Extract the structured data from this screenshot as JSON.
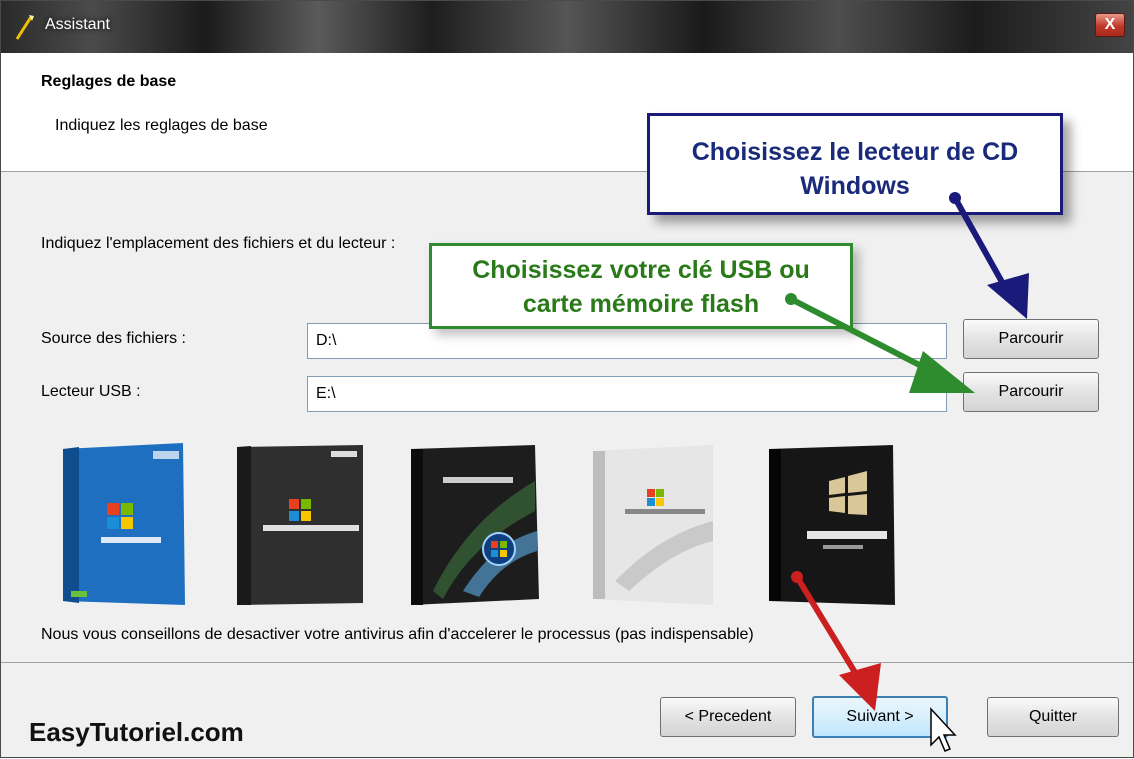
{
  "window": {
    "title": "Assistant",
    "close_label": "X"
  },
  "header": {
    "title": "Reglages de base",
    "subtitle": "Indiquez les reglages de base"
  },
  "main": {
    "intro": "Indiquez l'emplacement des fichiers et du lecteur :",
    "source": {
      "label": "Source des fichiers :",
      "value": "D:\\",
      "browse_label": "Parcourir"
    },
    "usb": {
      "label": "Lecteur USB :",
      "value": "E:\\",
      "browse_label": "Parcourir"
    },
    "product_boxes": [
      {
        "name": "Windows XP",
        "color": "#1e6fc0"
      },
      {
        "name": "Windows Server 2003",
        "color": "#3a3a3a"
      },
      {
        "name": "Windows Vista",
        "color": "#1d1d1d"
      },
      {
        "name": "Windows Server 2008",
        "color": "#dcdcdc"
      },
      {
        "name": "Windows 7",
        "color": "#151515"
      }
    ],
    "note": "Nous vous conseillons de desactiver votre antivirus afin d'accelerer le processus (pas indispensable)"
  },
  "footer": {
    "brand": "EasyTutoriel.com",
    "prev_label": "< Precedent",
    "next_label": "Suivant >",
    "quit_label": "Quitter"
  },
  "callouts": {
    "cd": {
      "line1": "Choisissez le lecteur de CD",
      "line2": "Windows",
      "color": "#1a1a7a"
    },
    "usb": {
      "line1": "Choisissez votre clé USB ou",
      "line2": "carte mémoire flash",
      "color": "#2e8b2e"
    },
    "arrow_next_color": "#cc1f1f"
  }
}
